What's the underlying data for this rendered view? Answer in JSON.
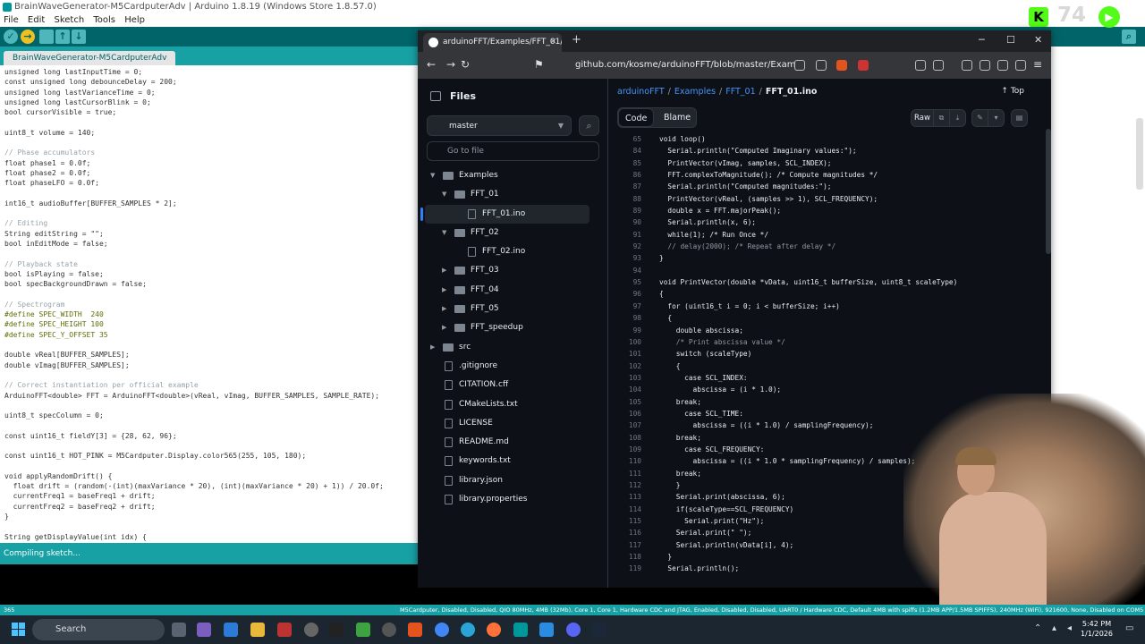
{
  "ide": {
    "title": "BrainWaveGenerator-M5CardputerAdv | Arduino 1.8.19 (Windows Store 1.8.57.0)",
    "menu": [
      "File",
      "Edit",
      "Sketch",
      "Tools",
      "Help"
    ],
    "tab": "BrainWaveGenerator-M5CardputerAdv",
    "status": "Compiling sketch...",
    "line_number": "365",
    "board_info": "M5Cardputer, Disabled, Disabled, QIO 80MHz, 4MB (32Mb), Core 1, Core 1, Hardware CDC and JTAG, Enabled, Disabled, Disabled, UART0 / Hardware CDC, Default 4MB with spiffs (1.2MB APP/1.5MB SPIFFS), 240MHz (WiFi), 921600, None, Disabled on COM5",
    "code": [
      "unsigned long lastInputTime = 0;",
      "const unsigned long debounceDelay = 200;",
      "unsigned long lastVarianceTime = 0;",
      "unsigned long lastCursorBlink = 0;",
      "bool cursorVisible = true;",
      "",
      "uint8_t volume = 140;",
      "",
      "// Phase accumulators",
      "float phase1 = 0.0f;",
      "float phase2 = 0.0f;",
      "float phaseLFO = 0.0f;",
      "",
      "int16_t audioBuffer[BUFFER_SAMPLES * 2];",
      "",
      "// Editing",
      "String editString = \"\";",
      "bool inEditMode = false;",
      "",
      "// Playback state",
      "bool isPlaying = false;",
      "bool specBackgroundDrawn = false;",
      "",
      "// Spectrogram",
      "#define SPEC_WIDTH  240",
      "#define SPEC_HEIGHT 100",
      "#define SPEC_Y_OFFSET 35",
      "",
      "double vReal[BUFFER_SAMPLES];",
      "double vImag[BUFFER_SAMPLES];",
      "",
      "// Correct instantiation per official example",
      "ArduinoFFT<double> FFT = ArduinoFFT<double>(vReal, vImag, BUFFER_SAMPLES, SAMPLE_RATE);",
      "",
      "uint8_t specColumn = 0;",
      "",
      "const uint16_t fieldY[3] = {28, 62, 96};",
      "",
      "const uint16_t HOT_PINK = M5Cardputer.Display.color565(255, 105, 180);",
      "",
      "void applyRandomDrift() {",
      "  float drift = (random(-(int)(maxVariance * 20), (int)(maxVariance * 20) + 1)) / 20.0f;",
      "  currentFreq1 = baseFreq1 + drift;",
      "  currentFreq2 = baseFreq2 + drift;",
      "}",
      "",
      "String getDisplayValue(int idx) {"
    ]
  },
  "browser": {
    "tab_title": "arduinoFFT/Examples/FFT_01/FF",
    "url": "github.com/kosme/arduinoFFT/blob/master/Examples/...",
    "files_title": "Files",
    "branch": "master",
    "goto_placeholder": "Go to file",
    "tree": [
      {
        "label": "Examples",
        "type": "folder",
        "open": true,
        "depth": 0
      },
      {
        "label": "FFT_01",
        "type": "folder",
        "open": true,
        "depth": 1
      },
      {
        "label": "FFT_01.ino",
        "type": "file",
        "depth": 2,
        "selected": true
      },
      {
        "label": "FFT_02",
        "type": "folder",
        "open": true,
        "depth": 1
      },
      {
        "label": "FFT_02.ino",
        "type": "file",
        "depth": 2
      },
      {
        "label": "FFT_03",
        "type": "folder",
        "open": false,
        "depth": 1
      },
      {
        "label": "FFT_04",
        "type": "folder",
        "open": false,
        "depth": 1
      },
      {
        "label": "FFT_05",
        "type": "folder",
        "open": false,
        "depth": 1
      },
      {
        "label": "FFT_speedup",
        "type": "folder",
        "open": false,
        "depth": 1
      },
      {
        "label": "src",
        "type": "folder",
        "open": false,
        "depth": 0
      },
      {
        "label": ".gitignore",
        "type": "file",
        "depth": 0
      },
      {
        "label": "CITATION.cff",
        "type": "file",
        "depth": 0
      },
      {
        "label": "CMakeLists.txt",
        "type": "file",
        "depth": 0
      },
      {
        "label": "LICENSE",
        "type": "file",
        "depth": 0
      },
      {
        "label": "README.md",
        "type": "file",
        "depth": 0
      },
      {
        "label": "keywords.txt",
        "type": "file",
        "depth": 0
      },
      {
        "label": "library.json",
        "type": "file",
        "depth": 0
      },
      {
        "label": "library.properties",
        "type": "file",
        "depth": 0
      }
    ],
    "breadcrumb": [
      "arduinoFFT",
      "Examples",
      "FFT_01",
      "FFT_01.ino"
    ],
    "top_label": "Top",
    "code_tab": "Code",
    "blame_tab": "Blame",
    "raw_label": "Raw",
    "code_lines": [
      {
        "n": "65",
        "t": "void loop()"
      },
      {
        "n": "84",
        "t": "  Serial.println(\"Computed Imaginary values:\");"
      },
      {
        "n": "85",
        "t": "  PrintVector(vImag, samples, SCL_INDEX);"
      },
      {
        "n": "86",
        "t": "  FFT.complexToMagnitude(); /* Compute magnitudes */"
      },
      {
        "n": "87",
        "t": "  Serial.println(\"Computed magnitudes:\");"
      },
      {
        "n": "88",
        "t": "  PrintVector(vReal, (samples >> 1), SCL_FREQUENCY);"
      },
      {
        "n": "89",
        "t": "  double x = FFT.majorPeak();"
      },
      {
        "n": "90",
        "t": "  Serial.println(x, 6);"
      },
      {
        "n": "91",
        "t": "  while(1); /* Run Once */"
      },
      {
        "n": "92",
        "t": "  // delay(2000); /* Repeat after delay */"
      },
      {
        "n": "93",
        "t": "}"
      },
      {
        "n": "94",
        "t": ""
      },
      {
        "n": "95",
        "t": "void PrintVector(double *vData, uint16_t bufferSize, uint8_t scaleType)"
      },
      {
        "n": "96",
        "t": "{"
      },
      {
        "n": "97",
        "t": "  for (uint16_t i = 0; i < bufferSize; i++)"
      },
      {
        "n": "98",
        "t": "  {"
      },
      {
        "n": "99",
        "t": "    double abscissa;"
      },
      {
        "n": "100",
        "t": "    /* Print abscissa value */"
      },
      {
        "n": "101",
        "t": "    switch (scaleType)"
      },
      {
        "n": "102",
        "t": "    {"
      },
      {
        "n": "103",
        "t": "      case SCL_INDEX:"
      },
      {
        "n": "104",
        "t": "        abscissa = (i * 1.0);"
      },
      {
        "n": "105",
        "t": "    break;"
      },
      {
        "n": "106",
        "t": "      case SCL_TIME:"
      },
      {
        "n": "107",
        "t": "        abscissa = ((i * 1.0) / samplingFrequency);"
      },
      {
        "n": "108",
        "t": "    break;"
      },
      {
        "n": "109",
        "t": "      case SCL_FREQUENCY:"
      },
      {
        "n": "110",
        "t": "        abscissa = ((i * 1.0 * samplingFrequency) / samples);"
      },
      {
        "n": "111",
        "t": "    break;"
      },
      {
        "n": "112",
        "t": "    }"
      },
      {
        "n": "113",
        "t": "    Serial.print(abscissa, 6);"
      },
      {
        "n": "114",
        "t": "    if(scaleType==SCL_FREQUENCY)"
      },
      {
        "n": "115",
        "t": "      Serial.print(\"Hz\");"
      },
      {
        "n": "116",
        "t": "    Serial.print(\" \");"
      },
      {
        "n": "117",
        "t": "    Serial.println(vData[i], 4);"
      },
      {
        "n": "118",
        "t": "  }"
      },
      {
        "n": "119",
        "t": "  Serial.println();"
      }
    ]
  },
  "overlay": {
    "kick_letter": "K",
    "viewer_count": "74"
  },
  "taskbar": {
    "search": "Search",
    "time": "5:42 PM",
    "date": "1/1/2026"
  },
  "colors": {
    "arduino_teal": "#17a1a5",
    "arduino_dark": "#006468",
    "github_bg": "#0d1117",
    "github_link": "#4493f8"
  }
}
